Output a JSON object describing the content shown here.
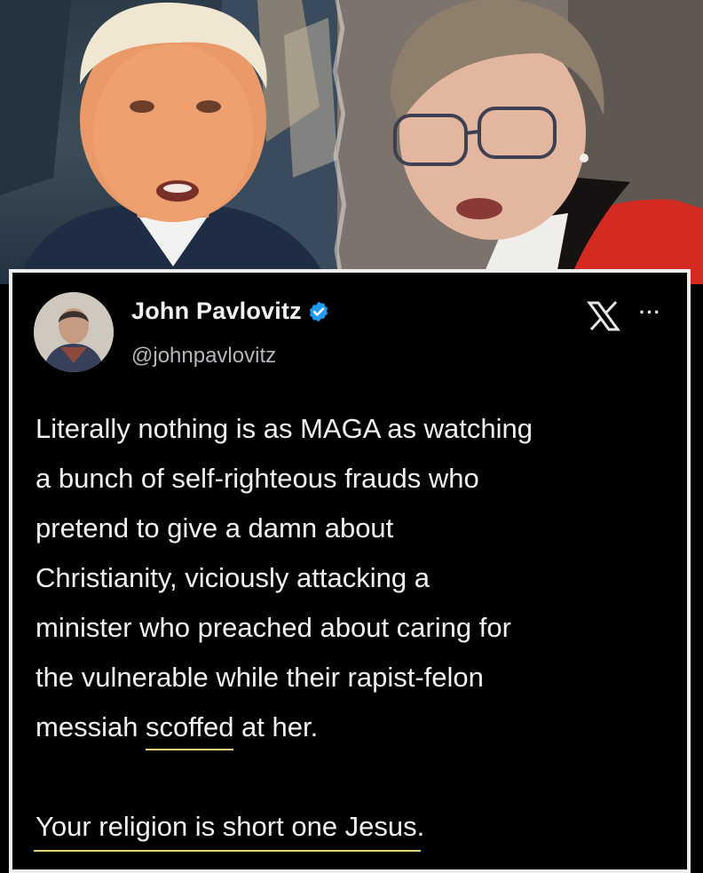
{
  "photos": {
    "left_alt": "man in dark suit",
    "right_alt": "bishop speaking"
  },
  "tweet": {
    "author_name": "John Pavlovitz",
    "author_handle": "@johnpavlovitz",
    "more_label": "···",
    "body_lines": [
      "Literally nothing is as MAGA as watching",
      "a bunch of self-righteous frauds who",
      "pretend to give a damn about",
      "Christianity, viciously attacking a",
      "minister who preached about caring for",
      "the vulnerable while their rapist-felon"
    ],
    "last_line_pre": "messiah ",
    "last_line_highlight": "scoffed",
    "last_line_post": " at her.",
    "closing": "Your religion is short one Jesus."
  },
  "colors": {
    "verified": "#1d9bf0",
    "underline": "#e8d07a",
    "card_border": "#eeeeee"
  }
}
